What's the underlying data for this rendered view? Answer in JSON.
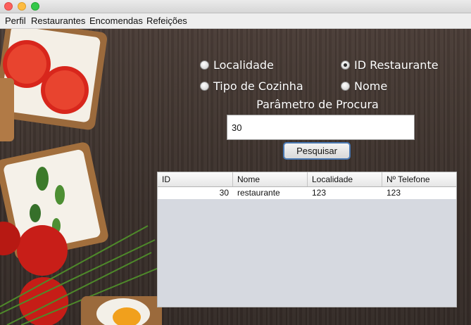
{
  "menu": {
    "items": [
      "Perfil",
      "Restaurantes",
      "Encomendas",
      "Refeições"
    ]
  },
  "search": {
    "options": [
      {
        "label": "Localidade",
        "selected": false
      },
      {
        "label": "ID Restaurante",
        "selected": true
      },
      {
        "label": "Tipo de Cozinha",
        "selected": false
      },
      {
        "label": "Nome",
        "selected": false
      }
    ],
    "param_label": "Parâmetro de Procura",
    "value": "30",
    "button_label": "Pesquisar"
  },
  "table": {
    "columns": [
      "ID",
      "Nome",
      "Localidade",
      "Nº Telefone"
    ],
    "rows": [
      [
        "30",
        "restaurante",
        "123",
        "123"
      ]
    ]
  },
  "colors": {
    "wood_background": "#3f332d",
    "button_border": "#4a79b3",
    "table_empty": "#d6d9e0"
  },
  "icons": {
    "window_controls": [
      "close-icon",
      "minimize-icon",
      "maximize-icon"
    ]
  }
}
